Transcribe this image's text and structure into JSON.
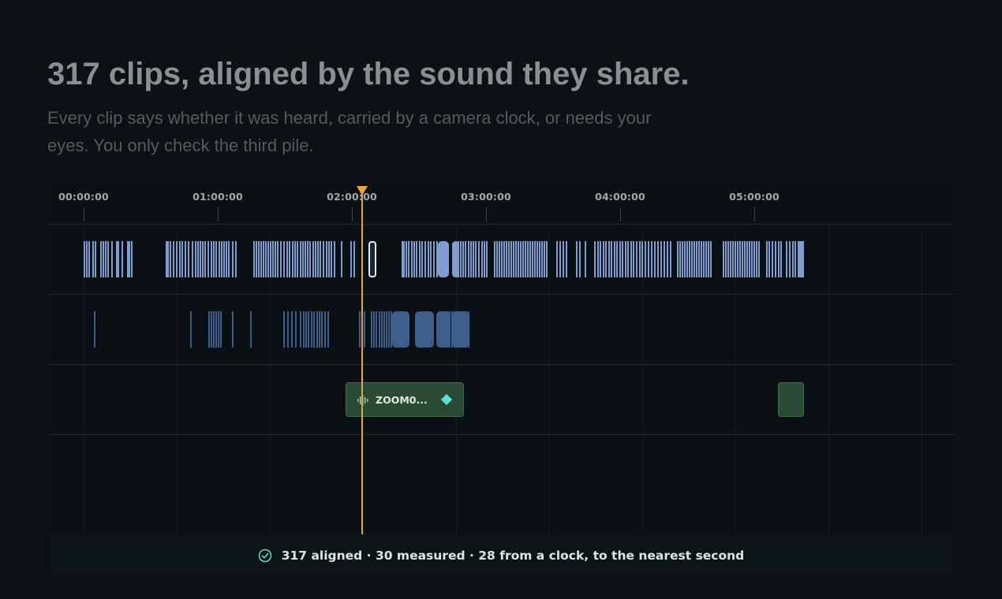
{
  "header": {
    "title": "317 clips, aligned by the sound they share.",
    "subtitle": "Every clip says whether it was heard, carried by a camera clock, or needs your eyes. You only check the third pile."
  },
  "timeline": {
    "timecodes": [
      "00:00:00",
      "01:00:00",
      "02:00:00",
      "03:00:00",
      "04:00:00",
      "05:00:00"
    ],
    "playhead_timecode": "02:05:00",
    "audio_clip": {
      "name": "ZOOM0...",
      "icon": "waveform-icon",
      "marker": "sync-diamond-icon"
    },
    "status": {
      "icon": "check-circle-icon",
      "text": "317 aligned · 30 measured · 28 from a clock, to the nearest second"
    }
  },
  "colors": {
    "background": "#0d1014",
    "video_clip": "#7f9dd1",
    "camera_clip": "#3d5d8b",
    "audio_clip": "#2b4a35",
    "playhead": "#f0a63a",
    "status_check": "#5ee0d4"
  }
}
